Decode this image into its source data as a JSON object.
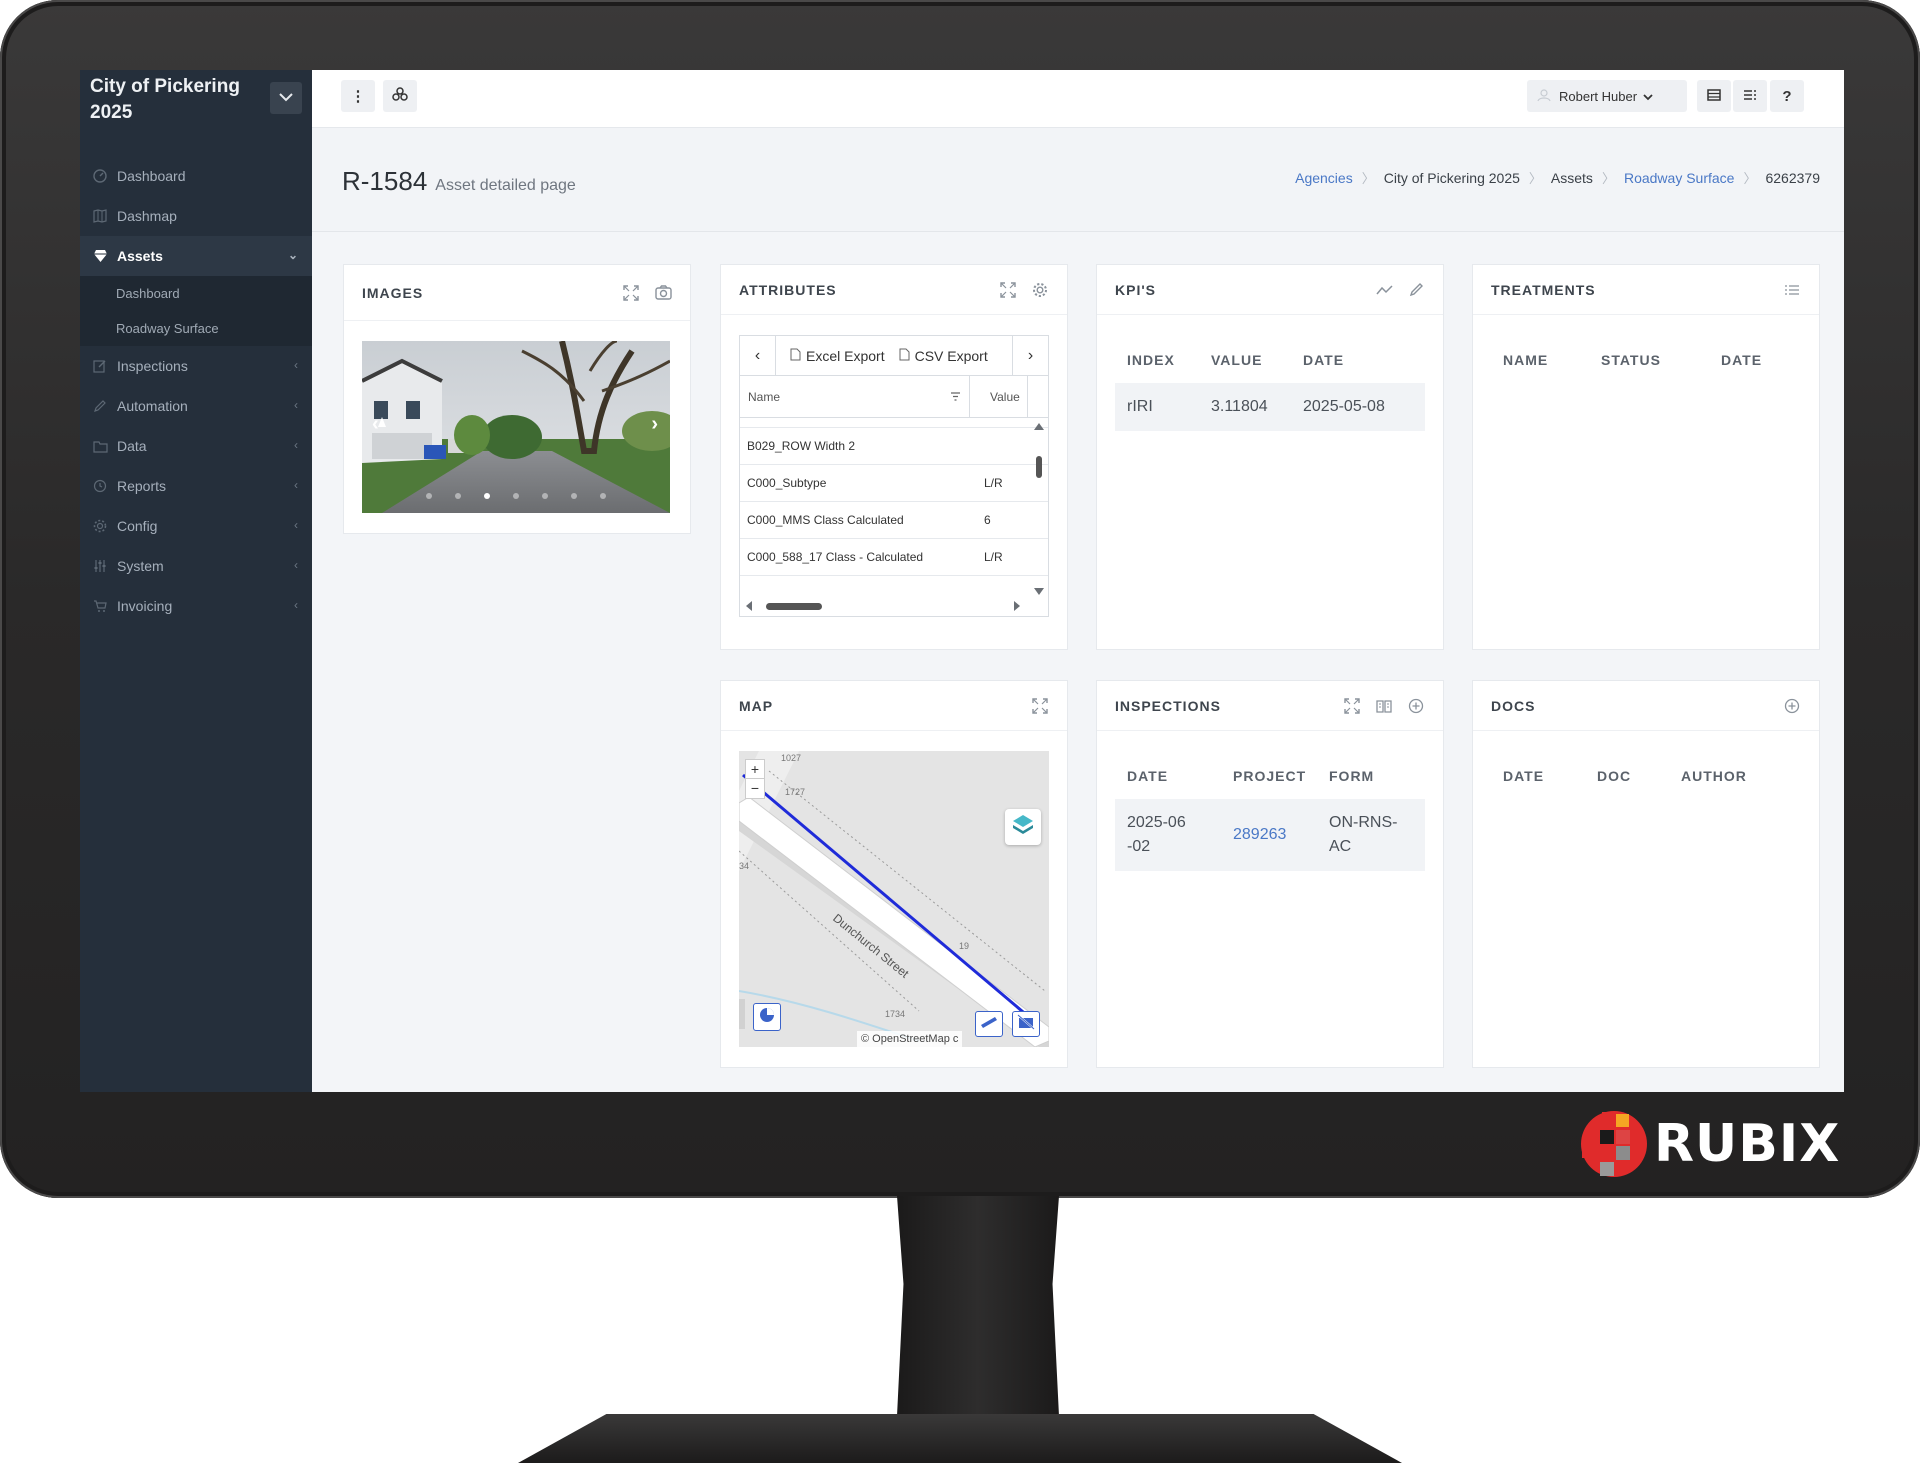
{
  "app": {
    "agency_line1": "City of Pickering",
    "agency_line2": "2025"
  },
  "sidebar": {
    "items": [
      {
        "label": "Dashboard",
        "icon": "gauge-icon"
      },
      {
        "label": "Dashmap",
        "icon": "map-icon"
      },
      {
        "label": "Assets",
        "icon": "diamond-icon",
        "active": true
      },
      {
        "label": "Inspections",
        "icon": "edit-icon"
      },
      {
        "label": "Automation",
        "icon": "pencil-icon"
      },
      {
        "label": "Data",
        "icon": "folder-icon"
      },
      {
        "label": "Reports",
        "icon": "history-icon"
      },
      {
        "label": "Config",
        "icon": "gear-icon"
      },
      {
        "label": "System",
        "icon": "sliders-icon"
      },
      {
        "label": "Invoicing",
        "icon": "cart-icon"
      }
    ],
    "assets_sub": [
      "Dashboard",
      "Roadway Surface"
    ]
  },
  "topbar": {
    "kebab_label": "⋮",
    "user_name": "Robert Huber",
    "help_label": "?"
  },
  "page": {
    "asset_id": "R-1584",
    "subtitle": "Asset detailed page"
  },
  "breadcrumb": [
    "Agencies",
    "City of Pickering 2025",
    "Assets",
    "Roadway Surface",
    "6262379"
  ],
  "images_card": {
    "title": "IMAGES",
    "slides": 7,
    "active_slide": 2
  },
  "attributes_card": {
    "title": "ATTRIBUTES",
    "excel_label": "Excel Export",
    "csv_label": "CSV Export",
    "col_name": "Name",
    "col_value": "Value",
    "rows": [
      {
        "name": "B029_ROW Width 2",
        "value": ""
      },
      {
        "name": "C000_Subtype",
        "value": "L/R"
      },
      {
        "name": "C000_MMS Class Calculated",
        "value": "6"
      },
      {
        "name": "C000_588_17 Class - Calculated",
        "value": "L/R"
      }
    ]
  },
  "kpi_card": {
    "title": "KPI'S",
    "headers": [
      "INDEX",
      "VALUE",
      "DATE"
    ],
    "rows": [
      {
        "index": "rIRI",
        "value": "3.11804",
        "date": "2025-05-08"
      }
    ]
  },
  "treatments_card": {
    "title": "TREATMENTS",
    "headers": [
      "NAME",
      "STATUS",
      "DATE"
    ]
  },
  "map_card": {
    "title": "MAP",
    "zoom_in": "+",
    "zoom_out": "−",
    "street_name": "Dunchurch Street",
    "labels": [
      "1027",
      "1727",
      "34",
      "19",
      "1734"
    ],
    "attribution": "© OpenStreetMap c"
  },
  "inspections_card": {
    "title": "INSPECTIONS",
    "headers": [
      "DATE",
      "PROJECT",
      "FORM"
    ],
    "rows": [
      {
        "date": "2025-06-02",
        "project": "289263",
        "form": "ON-RNS-AC"
      }
    ]
  },
  "docs_card": {
    "title": "DOCS",
    "headers": [
      "DATE",
      "DOC",
      "AUTHOR"
    ]
  },
  "brand": {
    "name": "RUBIX"
  },
  "colors": {
    "sidebar": "#252f3b",
    "link": "#4a78c6",
    "route_line": "#1f2bd9",
    "bezel": "#2a2929"
  }
}
